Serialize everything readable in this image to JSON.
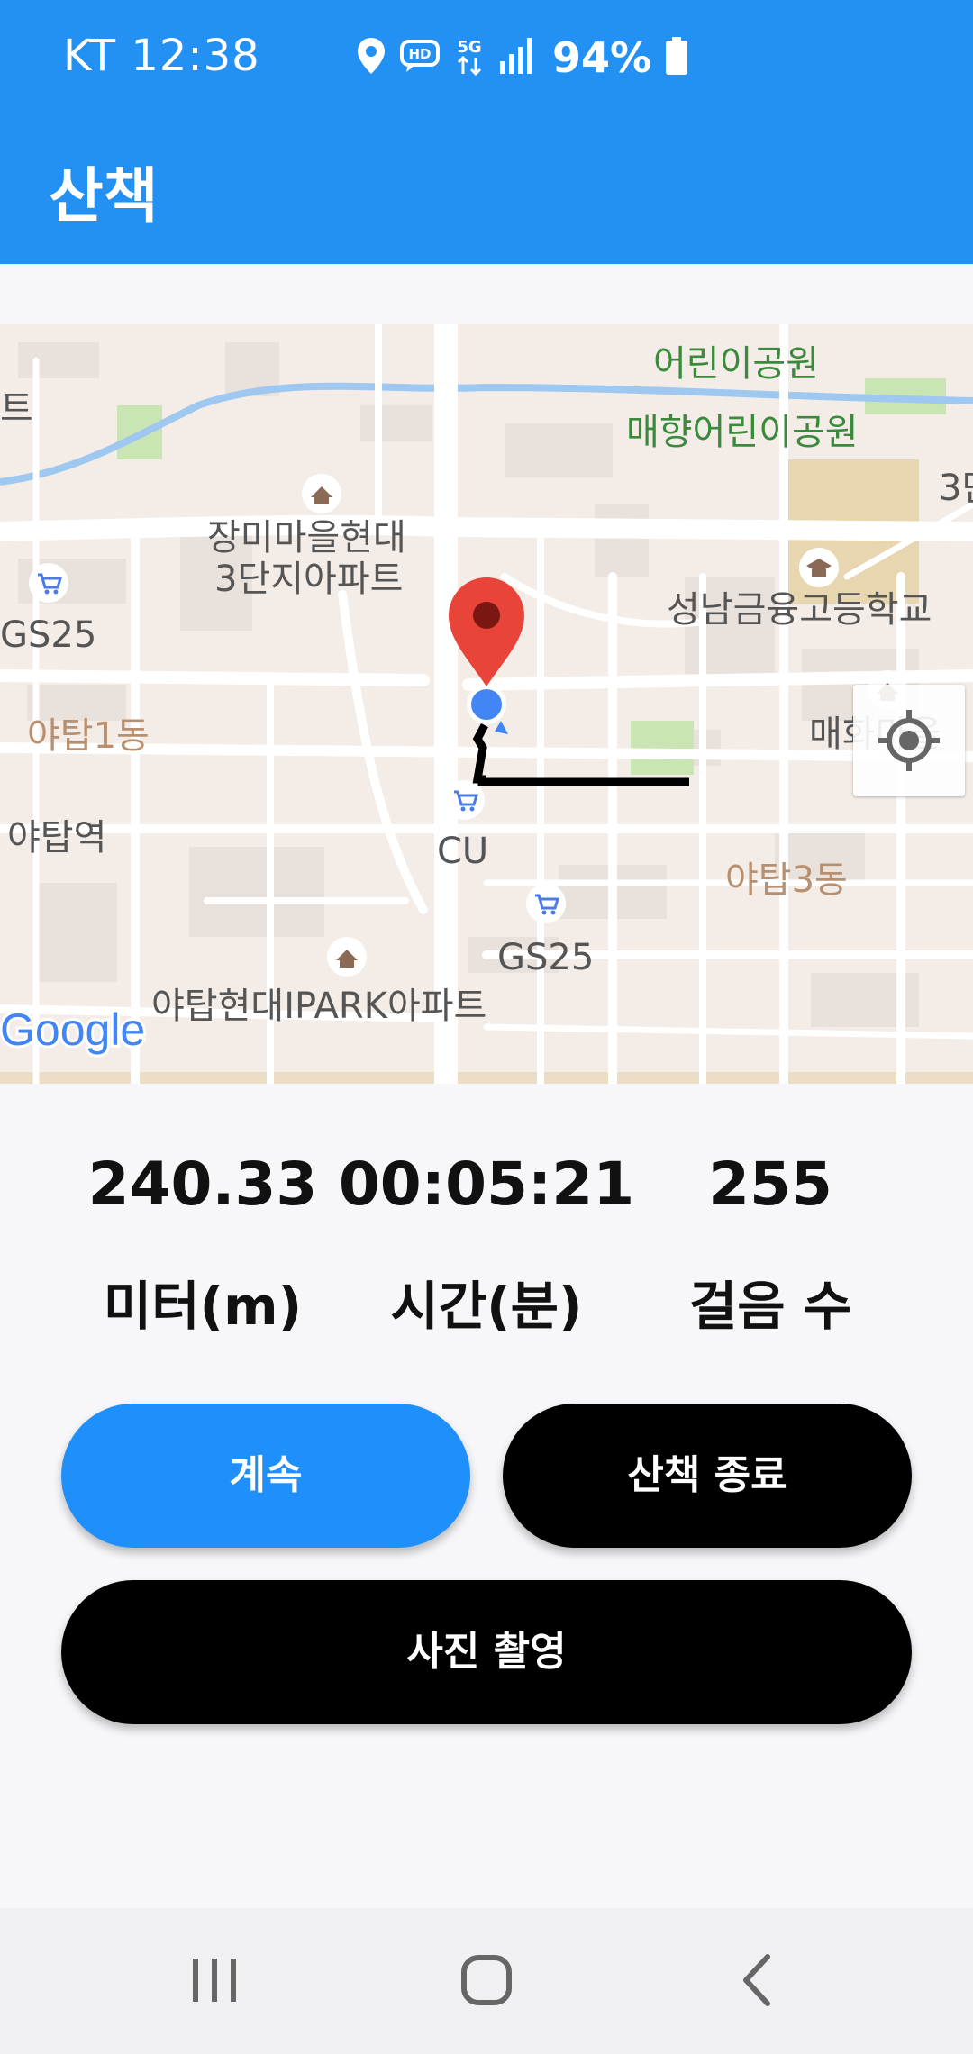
{
  "status_bar": {
    "carrier_time": "KT 12:38",
    "battery_text": "94%",
    "icons": [
      "location-icon",
      "hd-voice-icon",
      "5g-icon",
      "signal-icon",
      "battery-icon"
    ]
  },
  "app_bar": {
    "title": "산책"
  },
  "map": {
    "labels": {
      "park1": "어린이공원",
      "park2": "매향어린이공원",
      "apt1_line1": "장미마을현대",
      "apt1_line2": "3단지아파트",
      "gs25_left": "GS25",
      "school": "성남금융고등학교",
      "yatap1": "야탑1동",
      "maehwa": "매화마을",
      "yatap_station": "야탑역",
      "cu": "CU",
      "yatap3": "야탑3동",
      "gs25_bottom": "GS25",
      "ipark": "야탑현대IPARK아파트",
      "edge_t": "트",
      "edge_3": "3단",
      "google": "Google"
    },
    "icons": [
      "map-pin-icon",
      "current-location-dot-icon",
      "my-location-icon"
    ],
    "colors": {
      "route": "#000000",
      "pin": "#e8443a",
      "dot": "#4285f4"
    }
  },
  "stats": {
    "distance_value": "240.33",
    "time_value": "00:05:21",
    "steps_value": "255",
    "distance_label": "미터(m)",
    "time_label": "시간(분)",
    "steps_label": "걸음 수"
  },
  "buttons": {
    "continue": "계속",
    "end_walk": "산책 종료",
    "take_photo": "사진 촬영"
  },
  "nav_bar": {
    "icons": [
      "recent-apps-icon",
      "home-icon",
      "back-icon"
    ]
  },
  "colors": {
    "primary": "#2390f4",
    "button_blue": "#1f8ffb",
    "button_black": "#000000"
  }
}
